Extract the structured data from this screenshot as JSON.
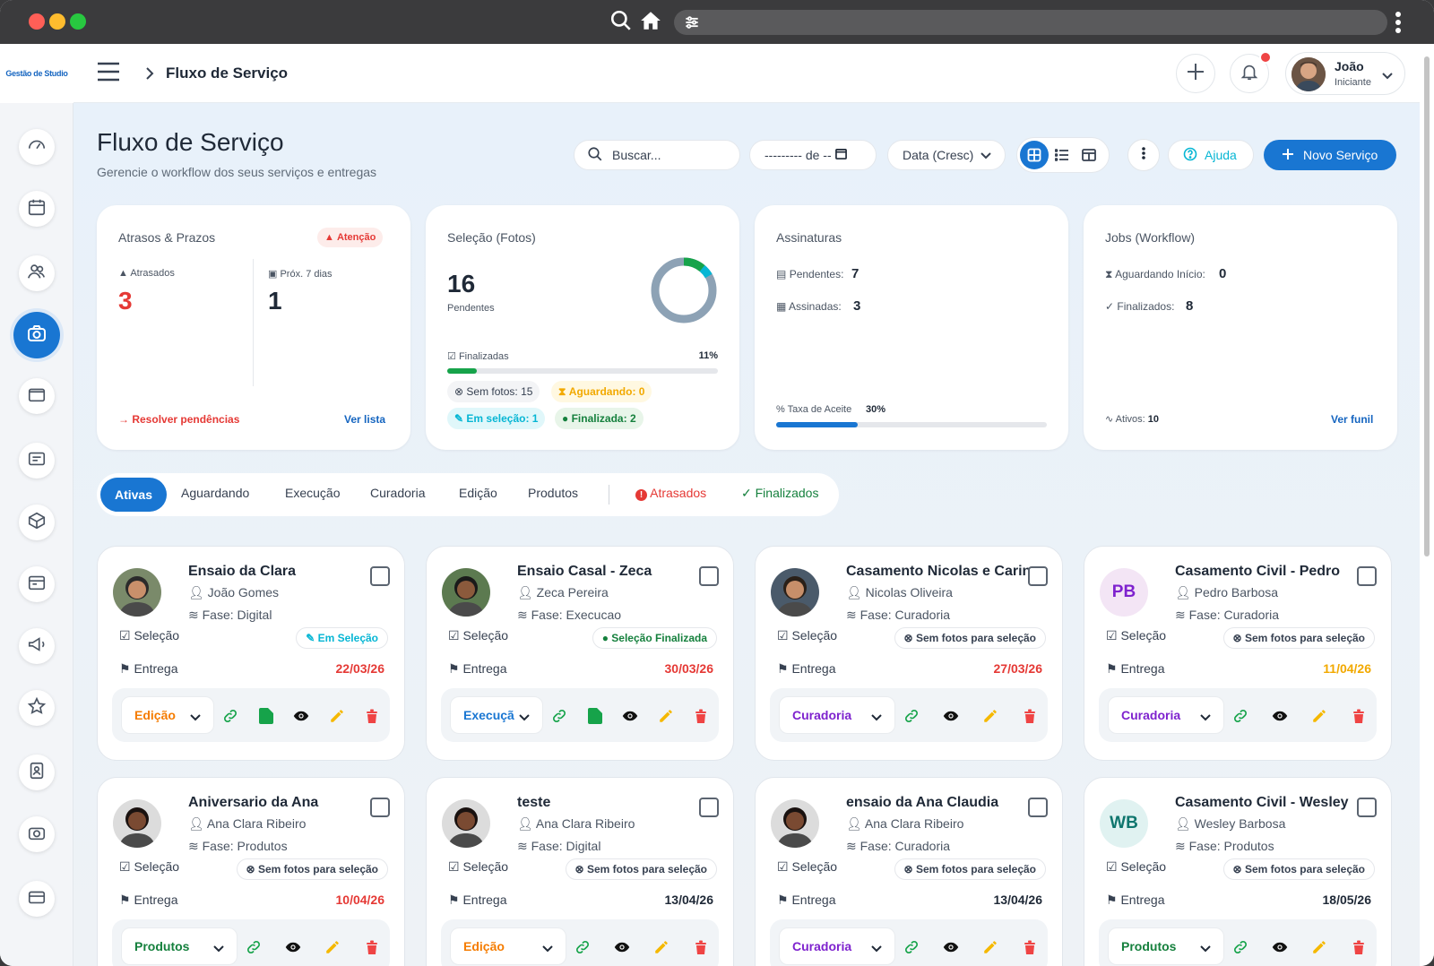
{
  "app": {
    "logo_text": "Gestão de Studio",
    "breadcrumb": "Fluxo de Serviço"
  },
  "user": {
    "name": "João",
    "role": "Iniciante"
  },
  "page": {
    "title": "Fluxo de Serviço",
    "subtitle": "Gerencie o workflow dos seus serviços e entregas"
  },
  "toolbar": {
    "search_placeholder": "Buscar...",
    "date_range": "--------- de --",
    "sort": "Data (Cresc)",
    "help": "Ajuda",
    "new_service": "Novo Serviço"
  },
  "summary": {
    "delays": {
      "title": "Atrasos & Prazos",
      "badge": "Atenção",
      "late_label": "Atrasados",
      "late_value": "3",
      "next_label": "Próx. 7 dias",
      "next_value": "1",
      "resolve": "Resolver pendências",
      "list": "Ver lista"
    },
    "selection": {
      "title": "Seleção (Fotos)",
      "pending_value": "16",
      "pending_label": "Pendentes",
      "finished_label": "Finalizadas",
      "finished_pct": "11%",
      "finished_fraction": 0.11,
      "no_photos": "Sem fotos: 15",
      "waiting": "Aguardando: 0",
      "in_selection": "Em seleção: 1",
      "finalized": "Finalizada: 2"
    },
    "signatures": {
      "title": "Assinaturas",
      "pending_label": "Pendentes:",
      "pending_value": "7",
      "signed_label": "Assinadas:",
      "signed_value": "3",
      "rate_label": "Taxa de Aceite",
      "rate_value": "30%",
      "rate_fraction": 0.3
    },
    "jobs": {
      "title": "Jobs (Workflow)",
      "waiting_label": "Aguardando Início:",
      "waiting_value": "0",
      "done_label": "Finalizados:",
      "done_value": "8",
      "active_label": "Ativos:",
      "active_value": "10",
      "funnel": "Ver funil"
    }
  },
  "tabs": [
    "Ativas",
    "Aguardando",
    "Execução",
    "Curadoria",
    "Edição",
    "Produtos",
    "Atrasados",
    "Finalizados"
  ],
  "labels": {
    "selection": "Seleção",
    "delivery": "Entrega",
    "phase_prefix": "Fase: "
  },
  "colors": {
    "primary": "#1976d2",
    "danger": "#e53935",
    "success": "#16a34a",
    "warning": "#f2a900",
    "cyan": "#06b6d4",
    "purple": "#7e22ce"
  },
  "jobs": [
    {
      "title": "Ensaio da Clara",
      "client": "João Gomes",
      "phase": "Fase: Digital",
      "status": "Em Seleção",
      "date": "22/03/26",
      "stage": "Edição"
    },
    {
      "title": "Ensaio Casal - Zeca",
      "client": "Zeca Pereira",
      "phase": "Fase: Execucao",
      "status": "Seleção Finalizada",
      "date": "30/03/26",
      "stage": "Execuçã"
    },
    {
      "title": "Casamento Nicolas e Carina",
      "client": "Nicolas Oliveira",
      "phase": "Fase: Curadoria",
      "status": "Sem fotos para seleção",
      "date": "27/03/26",
      "stage": "Curadoria"
    },
    {
      "title": "Casamento Civil - Pedro",
      "client": "Pedro Barbosa",
      "phase": "Fase: Curadoria",
      "status": "Sem fotos para seleção",
      "date": "11/04/26",
      "stage": "Curadoria",
      "initials": "PB"
    },
    {
      "title": "Aniversario da Ana",
      "client": "Ana Clara Ribeiro",
      "phase": "Fase: Produtos",
      "status": "Sem fotos para seleção",
      "date": "10/04/26",
      "stage": "Produtos"
    },
    {
      "title": "teste",
      "client": "Ana Clara Ribeiro",
      "phase": "Fase: Digital",
      "status": "Sem fotos para seleção",
      "date": "13/04/26",
      "stage": "Edição"
    },
    {
      "title": "ensaio da Ana Claudia",
      "client": "Ana Clara Ribeiro",
      "phase": "Fase: Curadoria",
      "status": "Sem fotos para seleção",
      "date": "13/04/26",
      "stage": "Curadoria"
    },
    {
      "title": "Casamento Civil - Wesley",
      "client": "Wesley Barbosa",
      "phase": "Fase: Produtos",
      "status": "Sem fotos para seleção",
      "date": "18/05/26",
      "stage": "Produtos",
      "initials": "WB"
    }
  ]
}
